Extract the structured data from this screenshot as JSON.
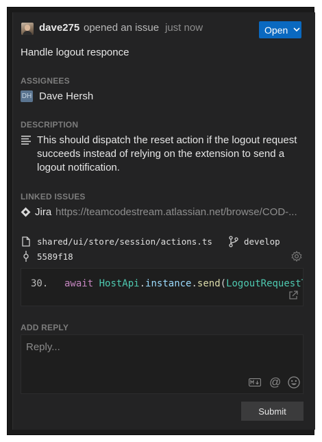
{
  "header": {
    "username": "dave275",
    "action": "opened an issue",
    "time": "just now",
    "status": "Open"
  },
  "issue": {
    "title": "Handle logout responce"
  },
  "assignees": {
    "label": "ASSIGNEES",
    "initials": "DH",
    "name": "Dave Hersh"
  },
  "description": {
    "label": "DESCRIPTION",
    "text": "This should dispatch the reset action if the logout request succeeds instead of relying on the extension to send a logout notification."
  },
  "linked_issues": {
    "label": "LINKED ISSUES",
    "provider": "Jira",
    "url": "https://teamcodestream.atlassian.net/browse/COD-..."
  },
  "code_marker": {
    "file": "shared/ui/store/session/actions.ts",
    "branch": "develop",
    "commit": "5589f18",
    "line_number": "30.",
    "code": {
      "kw": "await",
      "cls": "HostApi",
      "dot1": ".",
      "prop": "instance",
      "dot2": ".",
      "fn": "send",
      "paren": "(",
      "arg": "LogoutRequestTy"
    }
  },
  "reply": {
    "label": "ADD REPLY",
    "placeholder": "Reply...",
    "at_symbol": "@",
    "submit": "Submit"
  },
  "colors": {
    "background": "#232324",
    "status_button": "#0a69c0",
    "section_label": "#7c7c7c"
  },
  "icons": [
    "avatar",
    "chevron-down-icon",
    "description-icon",
    "jira-icon",
    "file-icon",
    "branch-icon",
    "commit-icon",
    "gear-icon",
    "open-external-icon",
    "markdown-icon",
    "at-icon",
    "emoji-icon"
  ]
}
